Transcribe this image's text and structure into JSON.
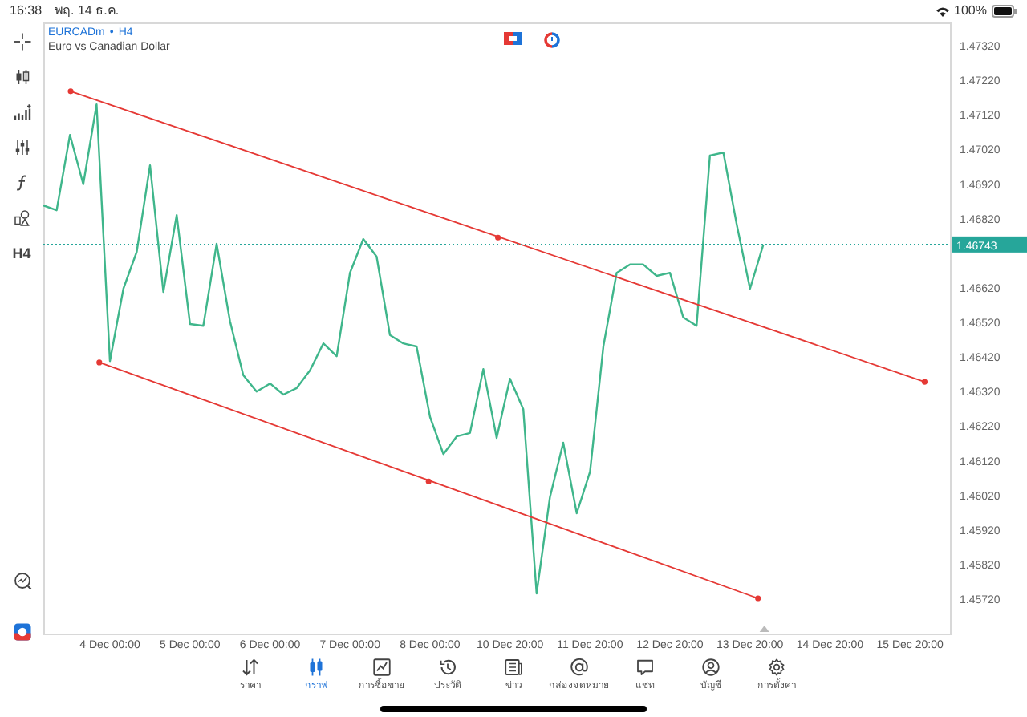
{
  "status_bar": {
    "time": "16:38",
    "date": "พฤ. 14 ธ.ค.",
    "battery": "100%"
  },
  "toolbar": [
    {
      "kind": "crosshair"
    },
    {
      "kind": "candles"
    },
    {
      "kind": "indicators"
    },
    {
      "kind": "sliders"
    },
    {
      "kind": "function"
    },
    {
      "kind": "shapes"
    },
    {
      "kind": "timeframe",
      "label": "H4"
    }
  ],
  "toolbar_bottom": [
    {
      "kind": "chart-search"
    },
    {
      "kind": "logo"
    }
  ],
  "chart": {
    "symbol": "EURCADm",
    "separator": "•",
    "timeframe": "H4",
    "description": "Euro vs Canadian Dollar",
    "overlays": [
      {
        "kind": "trend_line",
        "color": "#e53935"
      },
      {
        "kind": "trend_line",
        "color": "#e53935"
      }
    ],
    "chart_data": {
      "type": "line",
      "categories": [
        null,
        null,
        null,
        null,
        null,
        "4 Dec 00:00",
        null,
        null,
        null,
        null,
        null,
        "5 Dec 00:00",
        null,
        null,
        null,
        null,
        null,
        "6 Dec 00:00",
        null,
        null,
        null,
        null,
        null,
        "7 Dec 00:00",
        null,
        null,
        null,
        null,
        null,
        "8 Dec 00:00",
        null,
        null,
        null,
        null,
        null,
        "10 Dec 20:00",
        null,
        null,
        null,
        null,
        null,
        "11 Dec 20:00",
        null,
        null,
        null,
        null,
        null,
        "12 Dec 20:00",
        null,
        null,
        null,
        null,
        null,
        "13 Dec 20:00",
        null,
        null,
        null,
        null,
        null,
        "14 Dec 20:00",
        null,
        null,
        null,
        null,
        null,
        "15 Dec 20:00",
        null,
        null,
        null
      ],
      "series": [
        {
          "color": "#3fb68b",
          "values": [
            1.46856,
            1.46842,
            1.4706,
            1.46917,
            1.47148,
            1.46406,
            1.46615,
            1.46722,
            1.46972,
            1.46606,
            1.46828,
            1.46513,
            1.46508,
            1.46745,
            1.46522,
            1.46365,
            1.46318,
            1.46341,
            1.46309,
            1.46328,
            1.46379,
            1.46457,
            1.4642,
            1.46661,
            1.46759,
            1.46708,
            1.46481,
            1.46457,
            1.46448,
            1.46244,
            1.46137,
            1.46188,
            1.46198,
            1.46383,
            1.46184,
            1.46355,
            1.46267,
            1.45734,
            1.46012,
            1.4617,
            1.45966,
            1.46086,
            1.46448,
            1.46661,
            1.46685,
            1.46685,
            1.46652,
            1.46661,
            1.46532,
            1.46508,
            1.47,
            1.47009,
            1.46801,
            1.46615,
            1.46743,
            null,
            null,
            null,
            null,
            null,
            null,
            null,
            null,
            null,
            null,
            null,
            null,
            null,
            null
          ]
        }
      ],
      "ylim": [
        1.45618,
        1.47385
      ],
      "yticks": [
        {
          "value": 1.4732,
          "label": "1.47320"
        },
        {
          "value": 1.4722,
          "label": "1.47220"
        },
        {
          "value": 1.4712,
          "label": "1.47120"
        },
        {
          "value": 1.4702,
          "label": "1.47020"
        },
        {
          "value": 1.4692,
          "label": "1.46920"
        },
        {
          "value": 1.4682,
          "label": "1.46820"
        },
        {
          "value": 1.4662,
          "label": "1.46620"
        },
        {
          "value": 1.4652,
          "label": "1.46520"
        },
        {
          "value": 1.4642,
          "label": "1.46420"
        },
        {
          "value": 1.4632,
          "label": "1.46320"
        },
        {
          "value": 1.4622,
          "label": "1.46220"
        },
        {
          "value": 1.4612,
          "label": "1.46120"
        },
        {
          "value": 1.4602,
          "label": "1.46020"
        },
        {
          "value": 1.4592,
          "label": "1.45920"
        },
        {
          "value": 1.4582,
          "label": "1.45820"
        },
        {
          "value": 1.4572,
          "label": "1.45720"
        }
      ],
      "ylabel": null
    },
    "current_price": {
      "label": "1.46743",
      "color": "#26a69a"
    }
  },
  "tabs": [
    {
      "kind": "quotes",
      "label": "ราคา",
      "selected": false
    },
    {
      "kind": "chart",
      "label": "กราฟ",
      "selected": true
    },
    {
      "kind": "trade",
      "label": "การซื้อขาย",
      "selected": false
    },
    {
      "kind": "history",
      "label": "ประวัติ",
      "selected": false
    },
    {
      "kind": "news",
      "label": "ข่าว",
      "selected": false
    },
    {
      "kind": "mail",
      "label": "กล่องจดหมาย",
      "selected": false
    },
    {
      "kind": "chat",
      "label": "แชท",
      "selected": false
    },
    {
      "kind": "account",
      "label": "บัญชี",
      "selected": false
    },
    {
      "kind": "settings",
      "label": "การตั้งค่า",
      "selected": false
    }
  ]
}
